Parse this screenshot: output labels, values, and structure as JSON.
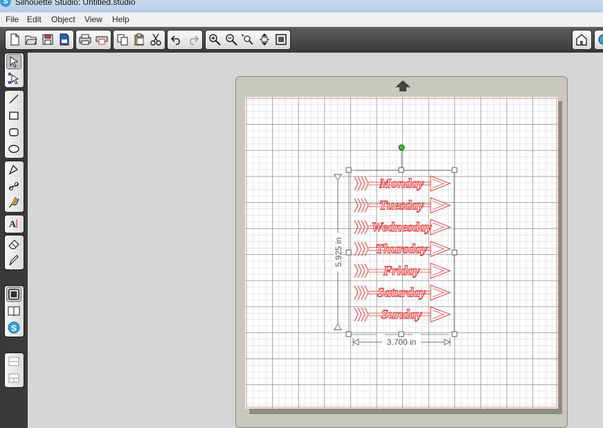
{
  "window": {
    "title": "Silhouette Studio: Untitled.studio",
    "app_icon": "S"
  },
  "menu": [
    {
      "label": "File"
    },
    {
      "label": "Edit"
    },
    {
      "label": "Object"
    },
    {
      "label": "View"
    },
    {
      "label": "Help"
    }
  ],
  "toolbar": {
    "icons": [
      "new-document-icon",
      "open-folder-icon",
      "save-icon",
      "save-to-sd-icon",
      "print-icon",
      "send-to-silhouette-icon",
      "copy-icon",
      "paste-icon",
      "cut-icon",
      "undo-icon",
      "redo-icon",
      "zoom-in-icon",
      "zoom-out-icon",
      "zoom-selection-icon",
      "pan-zoom-icon",
      "fit-to-page-icon",
      "design-store-icon"
    ]
  },
  "left_tools": {
    "icons": [
      "select-tool-icon",
      "point-edit-tool-icon",
      "line-tool-icon",
      "rectangle-tool-icon",
      "rounded-rectangle-tool-icon",
      "ellipse-tool-icon",
      "polygon-tool-icon",
      "curve-tool-icon",
      "freehand-tool-icon",
      "text-tool-icon",
      "eraser-tool-icon",
      "knife-tool-icon",
      "design-page-icon",
      "library-icon",
      "silhouette-store-icon",
      "panel-view-icon",
      "split-view-icon"
    ]
  },
  "canvas": {
    "feed_arrow": "up-arrow-icon",
    "height_dimension": "5.925 in",
    "width_dimension": "3.700 in",
    "design_words": [
      "Monday",
      "Tuesday",
      "Wednesday",
      "Thursday",
      "Friday",
      "Saturday",
      "Sunday"
    ],
    "colors": {
      "cut_line": "#e23a3a",
      "handle": "#ffffff",
      "rotate_handle": "#22cc22",
      "mat_grid": "#c9c9c9"
    }
  }
}
